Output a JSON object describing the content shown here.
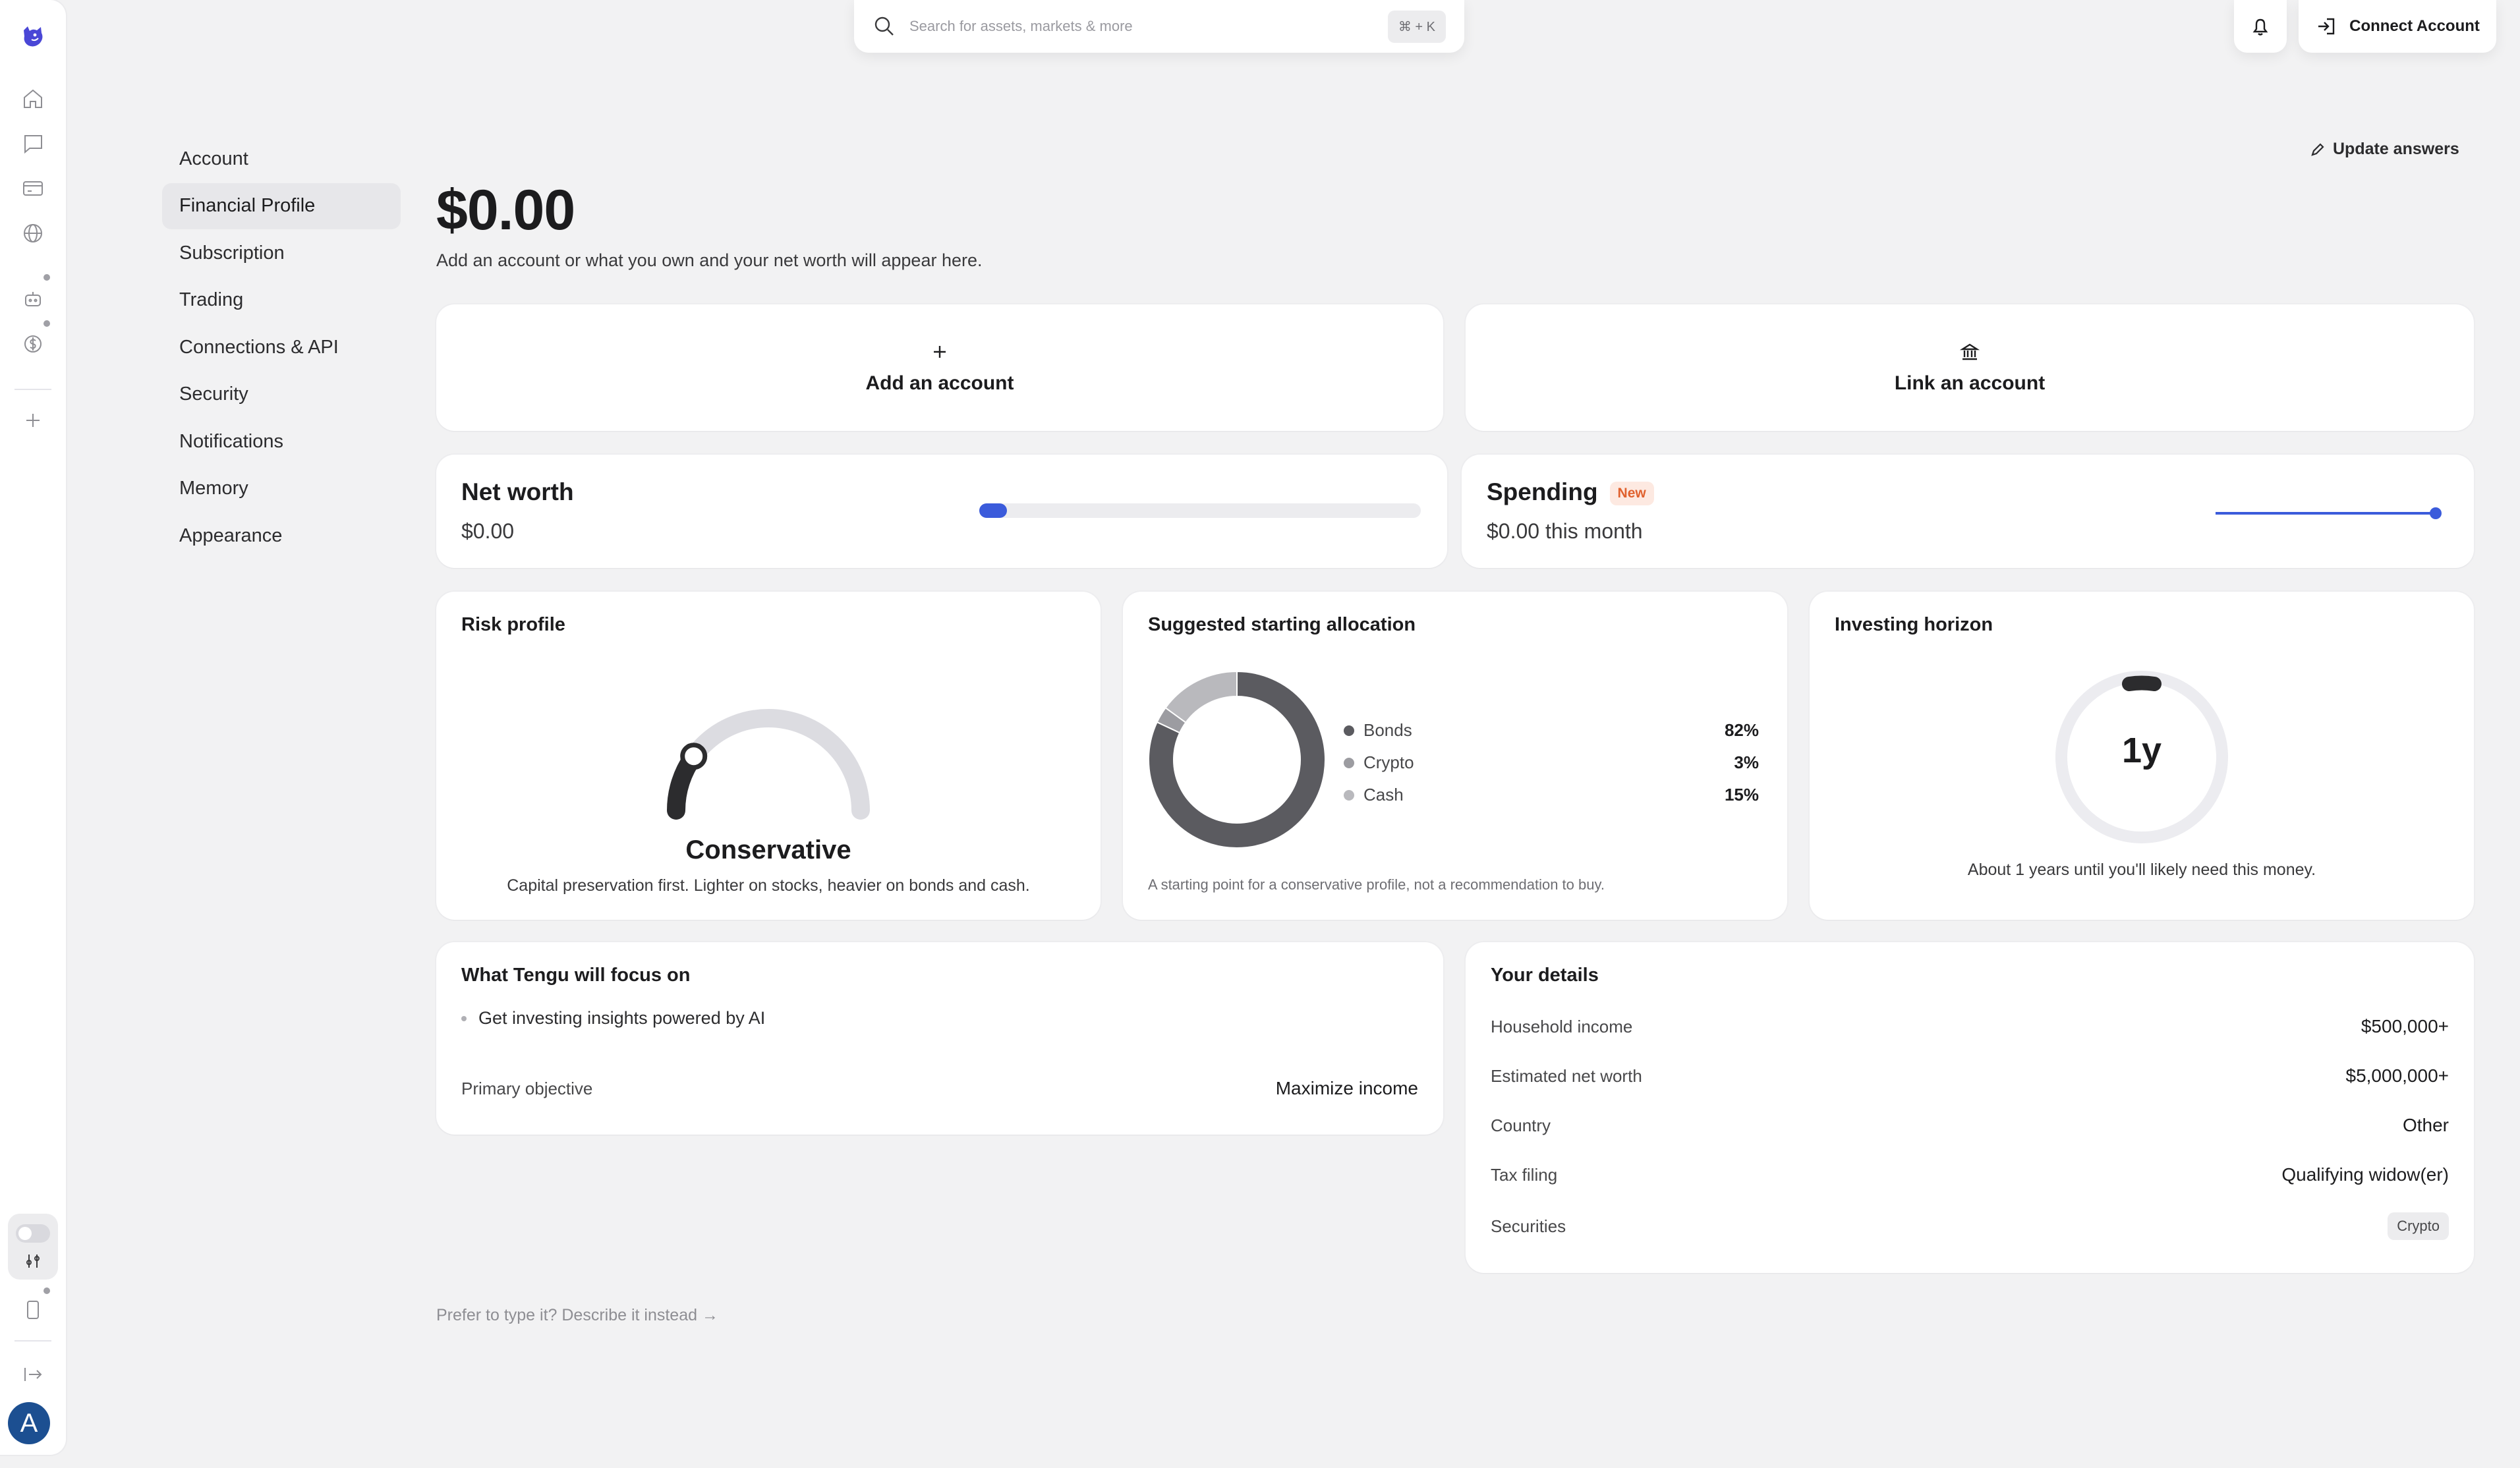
{
  "search": {
    "placeholder": "Search for assets, markets & more",
    "shortcut": "⌘ + K"
  },
  "header": {
    "connect_label": "Connect Account"
  },
  "user": {
    "avatar_initial": "A"
  },
  "nav": {
    "items": [
      {
        "label": "Account",
        "active": false
      },
      {
        "label": "Financial Profile",
        "active": true
      },
      {
        "label": "Subscription",
        "active": false
      },
      {
        "label": "Trading",
        "active": false
      },
      {
        "label": "Connections & API",
        "active": false
      },
      {
        "label": "Security",
        "active": false
      },
      {
        "label": "Notifications",
        "active": false
      },
      {
        "label": "Memory",
        "active": false
      },
      {
        "label": "Appearance",
        "active": false
      }
    ]
  },
  "main": {
    "update_label": "Update answers",
    "balance": "$0.00",
    "balance_sub": "Add an account or what you own and your net worth will appear here.",
    "add_account": "Add an account",
    "link_account": "Link an account",
    "net_worth": {
      "title": "Net worth",
      "value": "$0.00"
    },
    "spending": {
      "title": "Spending",
      "badge": "New",
      "value": "$0.00 this month"
    },
    "risk": {
      "title": "Risk profile",
      "label": "Conservative",
      "level": 0.2,
      "caption": "Capital preservation first. Lighter on stocks, heavier on bonds and cash."
    },
    "allocation": {
      "title": "Suggested starting allocation",
      "items": [
        {
          "name": "Bonds",
          "pct": "82%",
          "value": 82,
          "color": "#5b5b60"
        },
        {
          "name": "Crypto",
          "pct": "3%",
          "value": 3,
          "color": "#9c9ca1"
        },
        {
          "name": "Cash",
          "pct": "15%",
          "value": 15,
          "color": "#b9b9bd"
        }
      ],
      "caption": "A starting point for a conservative profile, not a recommendation to buy."
    },
    "horizon": {
      "title": "Investing horizon",
      "value": "1y",
      "caption": "About 1 years until you'll likely need this money."
    },
    "focus": {
      "title": "What Tengu will focus on",
      "bullet": "Get investing insights powered by AI",
      "objective_label": "Primary objective",
      "objective_value": "Maximize income"
    },
    "details": {
      "title": "Your details",
      "rows": [
        {
          "label": "Household income",
          "value": "$500,000+"
        },
        {
          "label": "Estimated net worth",
          "value": "$5,000,000+"
        },
        {
          "label": "Country",
          "value": "Other"
        },
        {
          "label": "Tax filing",
          "value": "Qualifying widow(er)"
        },
        {
          "label": "Securities",
          "value": "Crypto"
        }
      ]
    },
    "footnote": "Prefer to type it? Describe it instead →"
  },
  "colors": {
    "accent": "#3b5bdb",
    "dark": "#2c2c2e",
    "track": "#dcdce1"
  }
}
